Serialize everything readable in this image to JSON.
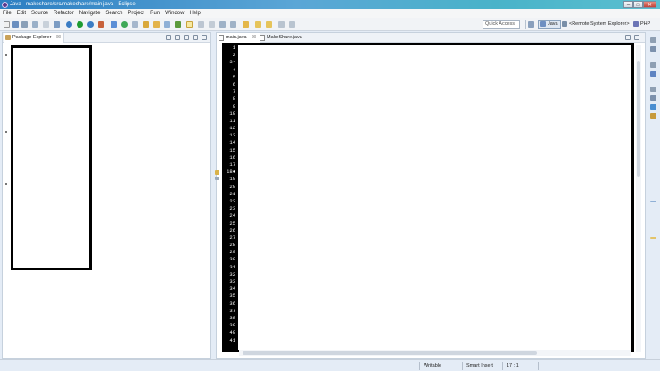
{
  "window": {
    "title": "Java - makeshare/src/makeshare/main.java - Eclipse"
  },
  "menu": [
    "File",
    "Edit",
    "Source",
    "Refactor",
    "Navigate",
    "Search",
    "Project",
    "Run",
    "Window",
    "Help"
  ],
  "toolbar": {
    "quick_access_placeholder": "Quick Access"
  },
  "perspectives": [
    "Java",
    "<Remote System Explorer>",
    "PHP"
  ],
  "package_explorer": {
    "tab_label": "Package Explorer",
    "close_glyph": "☒"
  },
  "editor": {
    "tabs": [
      {
        "label": "main.java",
        "close_glyph": "☒"
      },
      {
        "label": "MakeShare.java"
      }
    ],
    "line_numbers": [
      "1",
      "2",
      "3▪",
      "4",
      "5",
      "6",
      "7",
      "8",
      "9",
      "10",
      "11",
      "12",
      "13",
      "14",
      "15",
      "16",
      "17",
      "18●",
      "19",
      "20",
      "21",
      "22",
      "23",
      "24",
      "25",
      "26",
      "27",
      "28",
      "29",
      "30",
      "31",
      "32",
      "33",
      "34",
      "35",
      "36",
      "37",
      "38",
      "39",
      "40",
      "41"
    ]
  },
  "status": {
    "writable": "Writable",
    "insert_mode": "Smart Insert",
    "position": "17 : 1"
  }
}
